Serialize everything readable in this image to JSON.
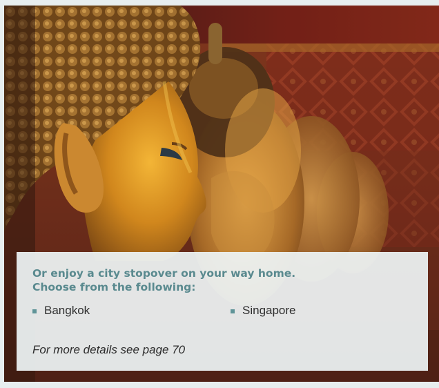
{
  "photo": {
    "icon": "buddha-statues-photo"
  },
  "panel": {
    "heading_line_1": "Or enjoy a city stopover on your way home.",
    "heading_line_2": "Choose from the following:",
    "items": [
      {
        "label": "Bangkok"
      },
      {
        "label": "Singapore"
      }
    ],
    "footer": "For more details see page 70"
  },
  "colors": {
    "accent": "#5a8a8f",
    "bullet": "#5f9498",
    "panel_bg": "#eef4f5",
    "text": "#2e2e2e"
  }
}
